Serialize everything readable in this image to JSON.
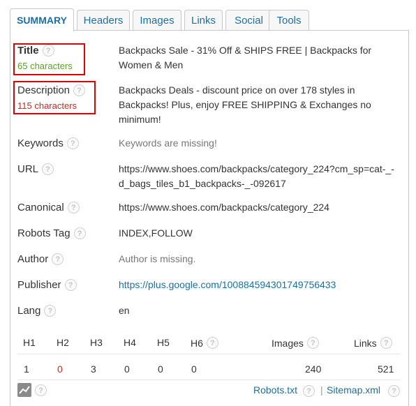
{
  "tabs": [
    {
      "label": "SUMMARY"
    },
    {
      "label": "Headers"
    },
    {
      "label": "Images"
    },
    {
      "label": "Links"
    },
    {
      "label": "Social"
    },
    {
      "label": "Tools"
    }
  ],
  "summary": {
    "title": {
      "label": "Title",
      "count": "65 characters",
      "value": "Backpacks Sale - 31% Off & SHIPS FREE | Backpacks for Women & Men"
    },
    "description": {
      "label": "Description",
      "count": "115 characters",
      "value": "Backpacks Deals - discount price on over 178 styles in Backpacks! Plus, enjoy FREE SHIPPING & Exchanges no minimum!"
    },
    "keywords": {
      "label": "Keywords",
      "value": "Keywords are missing!"
    },
    "url": {
      "label": "URL",
      "value": "https://www.shoes.com/backpacks/category_224?cm_sp=cat-_-d_bags_tiles_b1_backpacks-_-092617"
    },
    "canonical": {
      "label": "Canonical",
      "value": "https://www.shoes.com/backpacks/category_224"
    },
    "robots": {
      "label": "Robots Tag",
      "value": "INDEX,FOLLOW"
    },
    "author": {
      "label": "Author",
      "value": "Author is missing."
    },
    "publisher": {
      "label": "Publisher",
      "value": "https://plus.google.com/100884594301749756433"
    },
    "lang": {
      "label": "Lang",
      "value": "en"
    }
  },
  "stats": {
    "headers": [
      "H1",
      "H2",
      "H3",
      "H4",
      "H5",
      "H6",
      "Images",
      "Links"
    ],
    "values": [
      "1",
      "0",
      "3",
      "0",
      "0",
      "0",
      "240",
      "521"
    ]
  },
  "footer": {
    "robots_link": "Robots.txt",
    "separator": "|",
    "sitemap_link": "Sitemap.xml"
  },
  "icons": {
    "help": "?"
  },
  "colors": {
    "link": "#1a6fa8",
    "ok": "#5aa02c",
    "warn": "#e02020",
    "highlight": "#e00000"
  }
}
